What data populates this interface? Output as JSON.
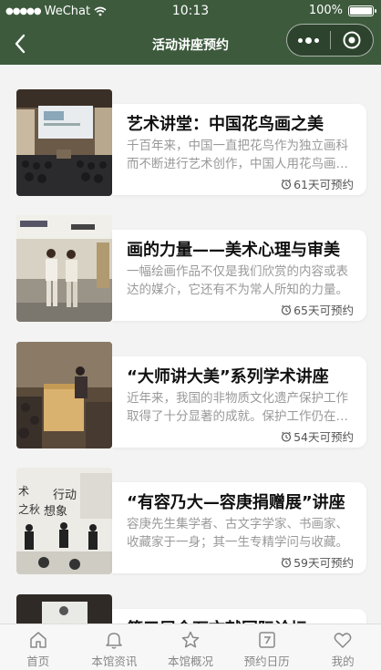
{
  "status": {
    "signal": "●●●●●",
    "carrier": "WeChat",
    "time": "10:13",
    "battery": "100%",
    "battery_level": 1.0
  },
  "nav": {
    "title": "活动讲座预约",
    "back_icon": "chevron-left-icon",
    "more_icon": "more-dots-icon",
    "close_icon": "target-close-icon"
  },
  "events": [
    {
      "title": "艺术讲堂：中国花鸟画之美",
      "desc": "千百年来，中国一直把花鸟作为独立画科而不断进行艺术创作，中国人用花鸟画寄托情感。",
      "due": "61天可预约"
    },
    {
      "title": "画的力量——美术心理与审美",
      "desc": "一幅绘画作品不仅是我们欣赏的内容或表达的媒介，它还有不为常人所知的力量。",
      "due": "65天可预约"
    },
    {
      "title": "“大师讲大美”系列学术讲座",
      "desc": "近年来，我国的非物质文化遗产保护工作取得了十分显著的成就。保护工作仍在进行。",
      "due": "54天可预约"
    },
    {
      "title": "“有容乃大—容庚捐赠展”讲座",
      "desc": "容庚先生集学者、古文字学家、书画家、收藏家于一身；其一生专精学问与收藏。",
      "due": "59天可预约"
    },
    {
      "title": "第三届金石文献国际论坛",
      "desc": "",
      "due": ""
    }
  ],
  "tabs": [
    {
      "label": "首页",
      "icon": "home-icon"
    },
    {
      "label": "本馆资讯",
      "icon": "bell-icon"
    },
    {
      "label": "本馆概况",
      "icon": "star-icon"
    },
    {
      "label": "预约日历",
      "icon": "calendar-icon"
    },
    {
      "label": "我的",
      "icon": "heart-icon"
    }
  ],
  "colors": {
    "header_bg": "#3d5a3d",
    "page_bg": "#f3f3f3",
    "tab_inactive": "#888888"
  }
}
